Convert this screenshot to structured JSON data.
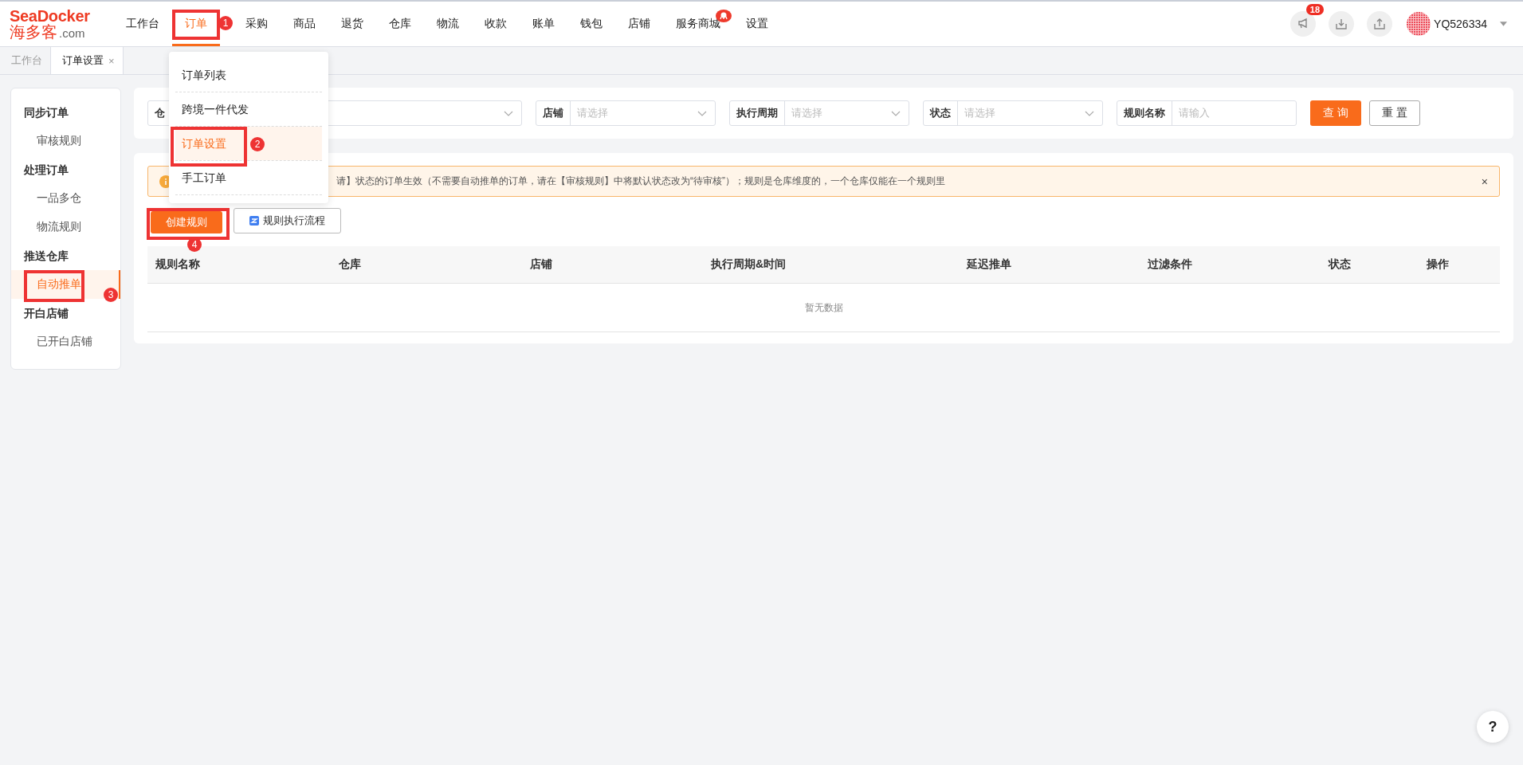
{
  "logo": {
    "brand": "SeaDocker",
    "name_cn": "海多客",
    "domain": ".com"
  },
  "nav": [
    {
      "label": "工作台",
      "selected": false
    },
    {
      "label": "订单",
      "selected": true,
      "step": "1"
    },
    {
      "label": "采购",
      "selected": false
    },
    {
      "label": "商品",
      "selected": false
    },
    {
      "label": "退货",
      "selected": false
    },
    {
      "label": "仓库",
      "selected": false
    },
    {
      "label": "物流",
      "selected": false
    },
    {
      "label": "收款",
      "selected": false
    },
    {
      "label": "账单",
      "selected": false
    },
    {
      "label": "钱包",
      "selected": false
    },
    {
      "label": "店铺",
      "selected": false
    },
    {
      "label": "服务商城",
      "selected": false,
      "badge": true
    },
    {
      "label": "设置",
      "selected": false
    }
  ],
  "notifications_count": "18",
  "user": {
    "name": "YQ526334"
  },
  "tabs": [
    {
      "label": "工作台",
      "selected": false
    },
    {
      "label": "订单设置",
      "selected": true,
      "close": "×"
    }
  ],
  "dropdown": [
    {
      "label": "订单列表",
      "selected": false
    },
    {
      "label": "跨境一件代发",
      "selected": false
    },
    {
      "label": "订单设置",
      "selected": true,
      "step": "2"
    },
    {
      "label": "手工订单",
      "selected": false
    }
  ],
  "sidebar": [
    {
      "group": "同步订单",
      "items": [
        {
          "label": "审核规则",
          "selected": false
        }
      ]
    },
    {
      "group": "处理订单",
      "items": [
        {
          "label": "一品多仓",
          "selected": false
        },
        {
          "label": "物流规则",
          "selected": false
        }
      ]
    },
    {
      "group": "推送仓库",
      "items": [
        {
          "label": "自动推单",
          "selected": true,
          "step": "3"
        }
      ]
    },
    {
      "group": "开白店铺",
      "items": [
        {
          "label": "已开白店铺",
          "selected": false
        }
      ]
    }
  ],
  "filters": [
    {
      "label": "仓"
    },
    {
      "label": "店铺",
      "placeholder": "请选择",
      "kind": "select"
    },
    {
      "label": "执行周期",
      "placeholder": "请选择",
      "kind": "select"
    },
    {
      "label": "状态",
      "placeholder": "请选择",
      "kind": "select"
    },
    {
      "label": "规则名称",
      "placeholder": "请输入",
      "kind": "input"
    }
  ],
  "search_button": "查 询",
  "reset_button": "重 置",
  "alert": {
    "text": "请】状态的订单生效（不需要自动推单的订单，请在【审核规则】中将默认状态改为“待审核”）；规则是仓库维度的，一个仓库仅能在一个规则里",
    "close": "×"
  },
  "actions": [
    {
      "label": "创建规则",
      "kind": "primary",
      "step": "4"
    },
    {
      "label": "规则执行流程",
      "kind": "doc"
    }
  ],
  "table": {
    "columns": [
      "规则名称",
      "仓库",
      "店铺",
      "执行周期&时间",
      "延迟推单",
      "过滤条件",
      "状态",
      "操作"
    ],
    "empty_text": "暂无数据"
  },
  "help": "?"
}
